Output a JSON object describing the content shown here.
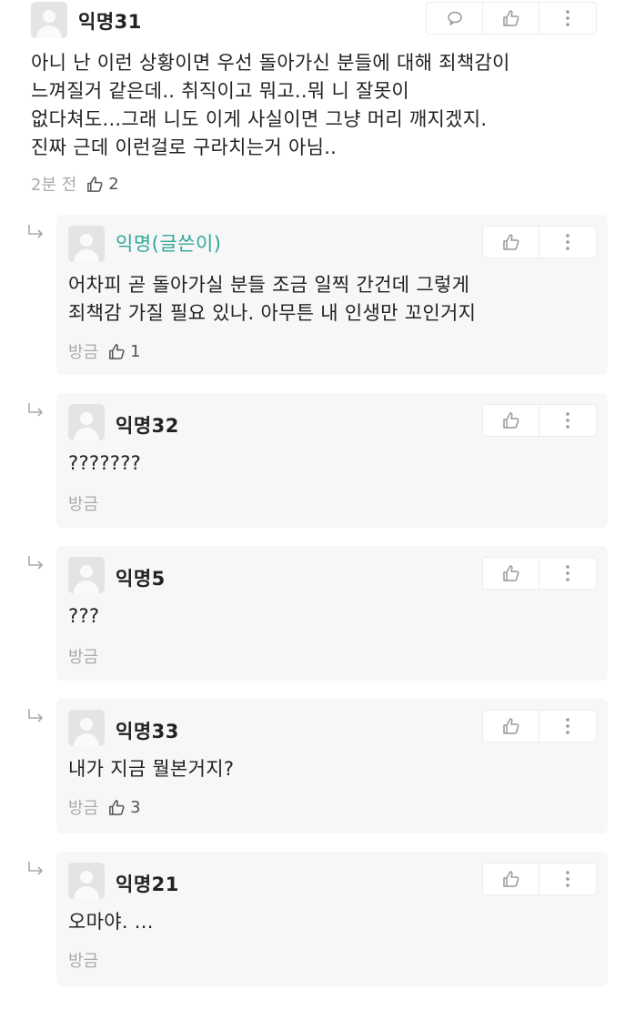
{
  "comment": {
    "author": "익명31",
    "text": "아니 난 이런 상황이면 우선 돌아가신 분들에 대해 죄책감이\n느껴질거 같은데.. 취직이고 뭐고..뭐 니 잘못이\n없다쳐도...그래 니도 이게 사실이면 그냥 머리 깨지겠지.\n진짜 근데 이런걸로 구라치는거 아님..",
    "time": "2분 전",
    "likes": "2"
  },
  "replies": [
    {
      "author": "익명(글쓴이)",
      "text": "어차피 곧 돌아가실 분들 조금 일찍 간건데 그렇게\n죄책감 가질 필요 있나. 아무튼 내 인생만 꼬인거지",
      "time": "방금",
      "likes": "1"
    },
    {
      "author": "익명32",
      "text": "???????",
      "time": "방금",
      "likes": ""
    },
    {
      "author": "익명5",
      "text": "???",
      "time": "방금",
      "likes": ""
    },
    {
      "author": "익명33",
      "text": "내가 지금 뭘본거지?",
      "time": "방금",
      "likes": "3"
    },
    {
      "author": "익명21",
      "text": "오마야. ...",
      "time": "방금",
      "likes": ""
    }
  ],
  "icons": {
    "comment": "speech-bubble-icon",
    "like": "thumbs-up-icon",
    "more": "vertical-dots-icon",
    "reply": "reply-arrow-icon"
  },
  "colors": {
    "op_author": "#2fa89a",
    "reply_bg": "#f7f7f7",
    "meta": "#aaaaaa"
  }
}
